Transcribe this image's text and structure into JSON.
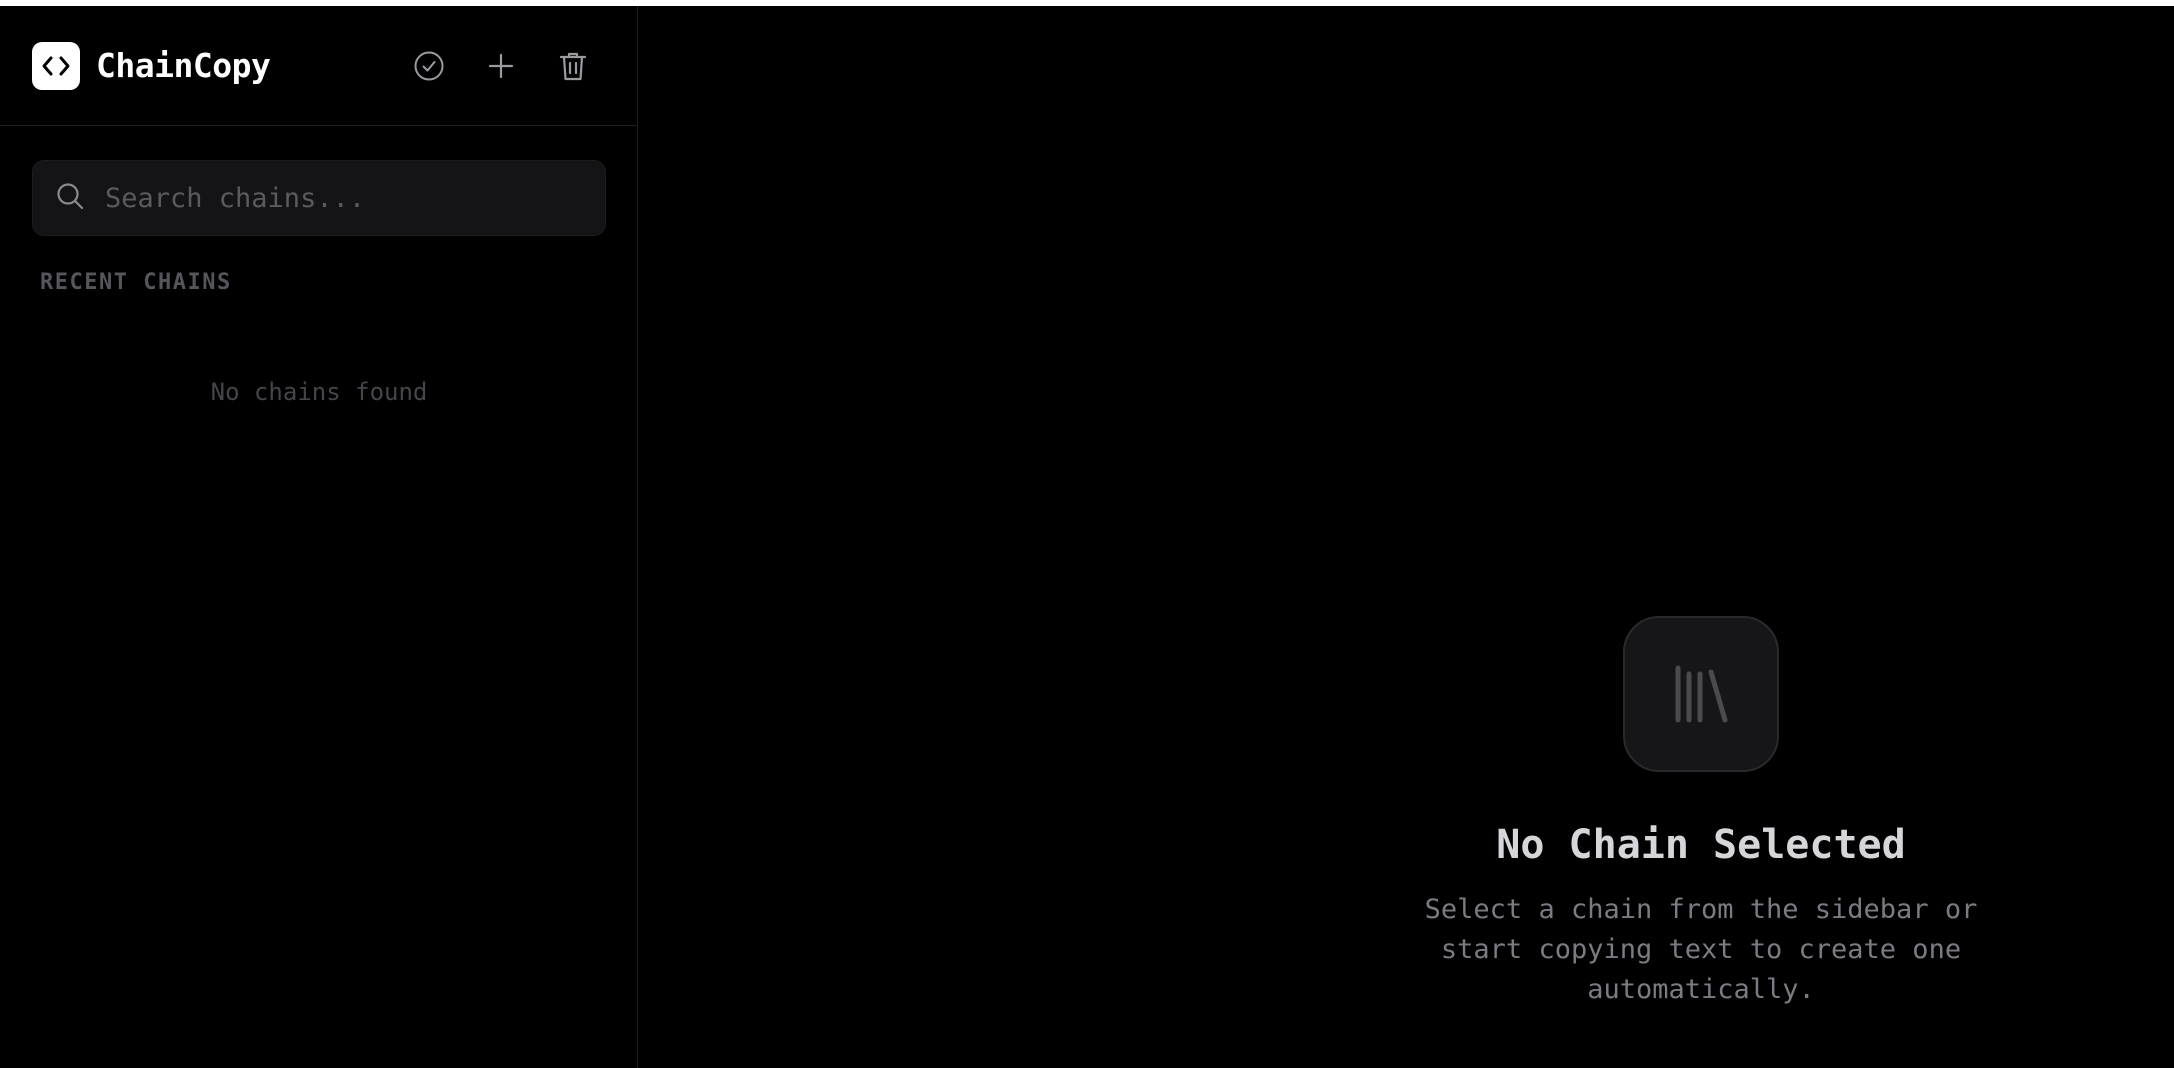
{
  "app": {
    "name": "ChainCopy",
    "logo_icon": "code-brackets-icon"
  },
  "header_actions": [
    {
      "name": "check-circle-icon",
      "title": "Mark done"
    },
    {
      "name": "plus-icon",
      "title": "New chain"
    },
    {
      "name": "trash-icon",
      "title": "Delete"
    }
  ],
  "search": {
    "placeholder": "Search chains...",
    "value": ""
  },
  "sidebar": {
    "section_title": "RECENT CHAINS",
    "empty_text": "No chains found"
  },
  "main": {
    "empty_icon": "library-icon",
    "title": "No Chain Selected",
    "description": "Select a chain from the sidebar or start copying text to create one automatically."
  },
  "colors": {
    "background": "#000000",
    "panel": "#141416",
    "border": "#1f1f22",
    "brand": "#ffffff",
    "muted_text": "#55555c"
  }
}
